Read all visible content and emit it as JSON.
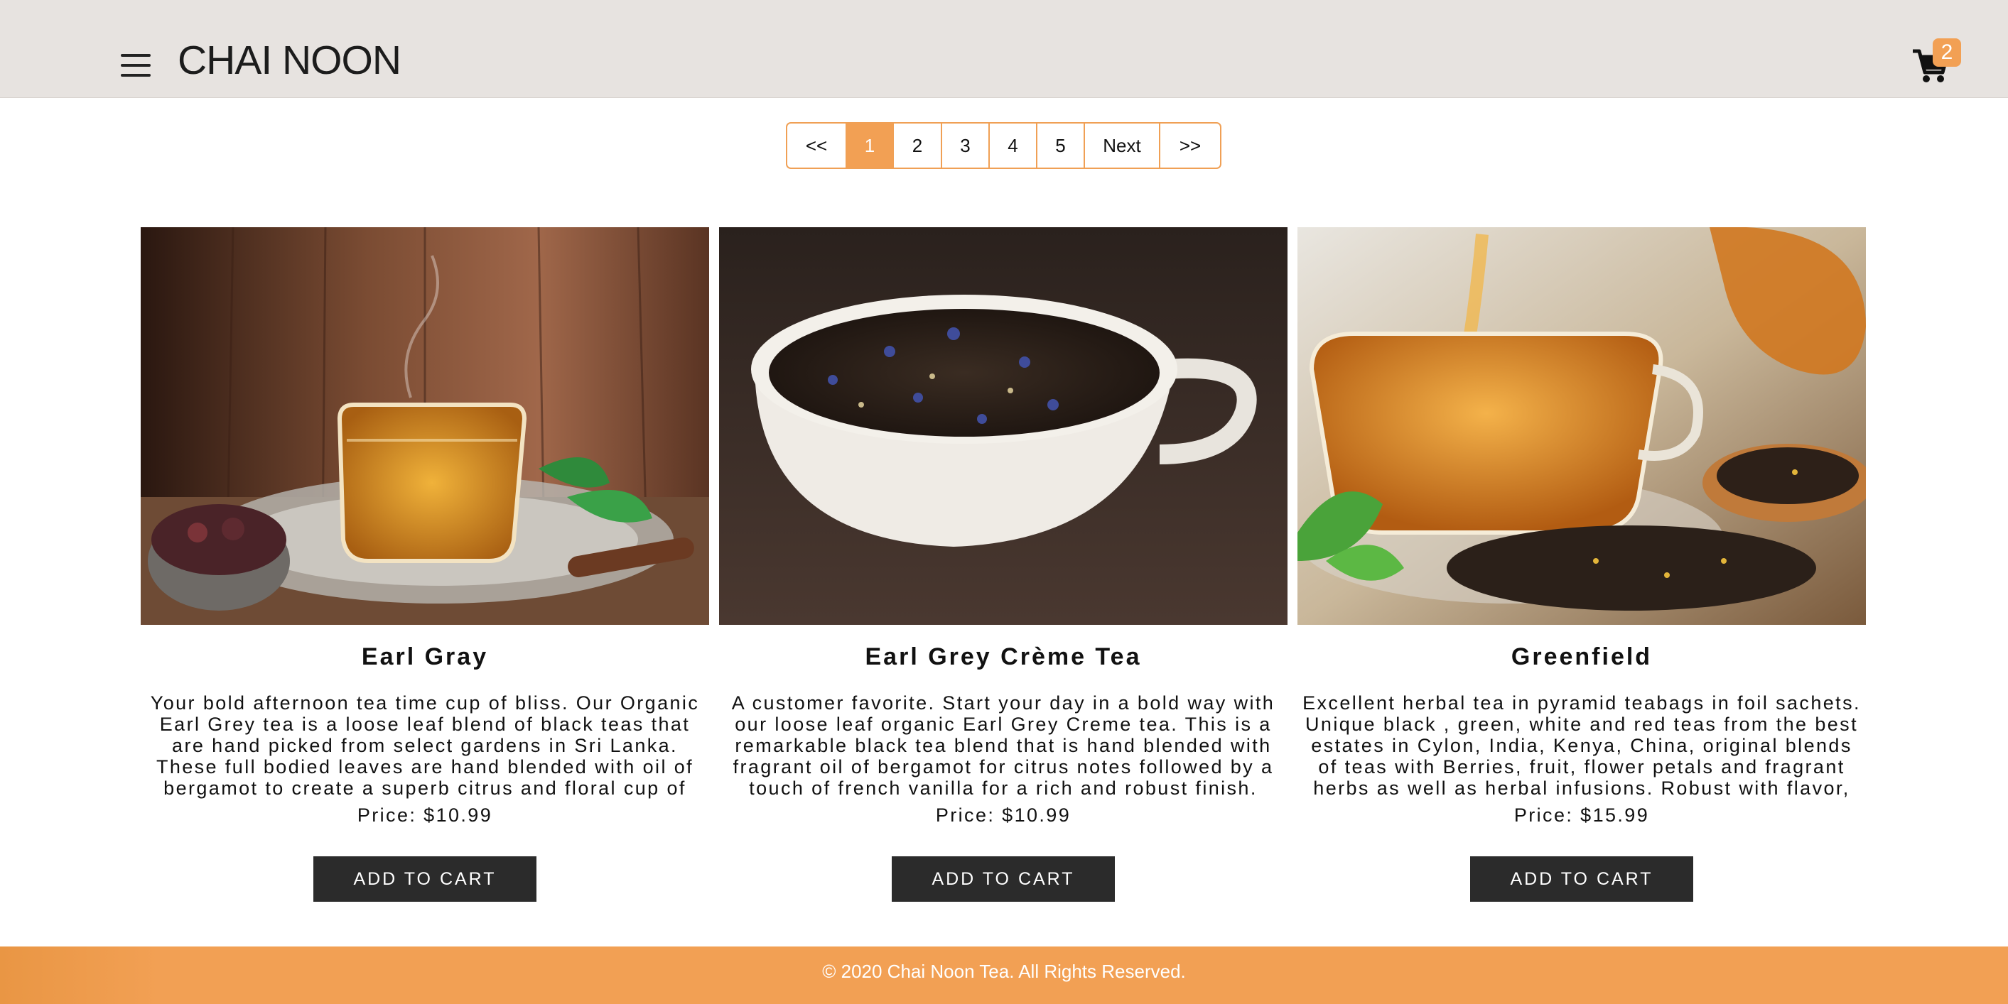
{
  "header": {
    "logo": "CHAI NOON",
    "cart_count": "2"
  },
  "pagination": {
    "items": [
      "<<",
      "1",
      "2",
      "3",
      "4",
      "5",
      "Next",
      ">>"
    ],
    "active": "1"
  },
  "products": [
    {
      "title": "Earl Gray",
      "description": "Your bold afternoon tea time cup of bliss. Our Organic Earl Grey tea is a loose leaf blend of black teas that are hand picked from select gardens in Sri Lanka. These full bodied leaves are hand blended with oil of bergamot to create a superb citrus and floral cup of tea.",
      "price": "Price: $10.99",
      "button": "ADD TO CART"
    },
    {
      "title": "Earl Grey Crème Tea",
      "description": "A customer favorite. Start your day in a bold way with our loose leaf organic Earl Grey Creme tea. This is a remarkable black tea blend that is hand blended with fragrant oil of bergamot for citrus notes followed by a touch of french vanilla for a rich and robust finish.",
      "price": "Price: $10.99",
      "button": "ADD TO CART"
    },
    {
      "title": "Greenfield",
      "description": "Excellent herbal tea in pyramid teabags in foil sachets. Unique black , green, white and red teas from the best estates in Cylon, India, Kenya, China, original blends of teas with Berries, fruit, flower petals and fragrant herbs as well as herbal infusions. Robust with flavor, not traditional blends for special moods of every tea lover.",
      "price": "Price: $15.99",
      "button": "ADD TO CART"
    }
  ],
  "footer": {
    "text": "© 2020 Chai Noon Tea. All Rights Reserved."
  },
  "colors": {
    "accent": "#f2a054",
    "header_bg": "#e7e3e0",
    "button_bg": "#2b2b2b"
  }
}
